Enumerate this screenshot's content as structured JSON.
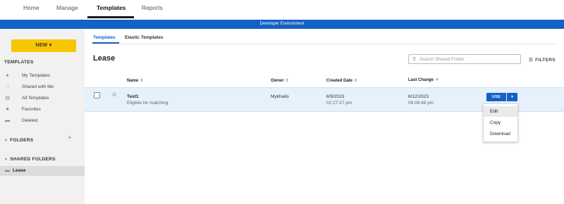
{
  "nav": {
    "tabs": [
      "Home",
      "Manage",
      "Templates",
      "Reports"
    ],
    "active": "Templates"
  },
  "env_banner": "Developer Environment",
  "sidebar": {
    "new_label": "NEW ▾",
    "templates_heading": "TEMPLATES",
    "items": [
      {
        "label": "My Templates",
        "icon": "user-icon"
      },
      {
        "label": "Shared with Me",
        "icon": "users-icon"
      },
      {
        "label": "All Templates",
        "icon": "list-icon"
      },
      {
        "label": "Favorites",
        "icon": "star-icon"
      },
      {
        "label": "Deleted",
        "icon": "trash-icon"
      }
    ],
    "folders_heading": "FOLDERS",
    "shared_folders_heading": "SHARED FOLDERS",
    "shared_folder": "Lease"
  },
  "subtabs": [
    "Templates",
    "Elastic Templates"
  ],
  "page_title": "Lease",
  "search": {
    "placeholder": "Search Shared Folder",
    "value": ""
  },
  "filters_label": "FILTERS",
  "table": {
    "columns": [
      "Name",
      "Owner",
      "Created Date",
      "Last Change"
    ],
    "rows": [
      {
        "name": "Test1",
        "subtitle": "Eligible for matching",
        "owner": "Mykhailo",
        "created_date": "6/9/2023",
        "created_time": "02:27:27 pm",
        "last_change_date": "6/12/2023",
        "last_change_time": "06:08:48 pm"
      }
    ]
  },
  "use_label": "USE",
  "menu": [
    "Edit",
    "Copy",
    "Download"
  ],
  "colors": {
    "accent": "#1461c7",
    "new_button": "#f7c600"
  }
}
